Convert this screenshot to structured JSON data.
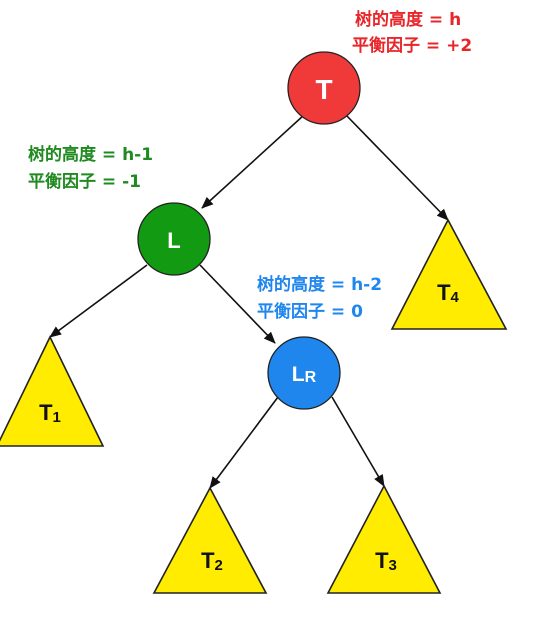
{
  "colors": {
    "root": "#f03a3a",
    "left": "#139a13",
    "lr": "#1f86ee",
    "subtree": "#ffec00",
    "red_text": "#e8262a",
    "green_text": "#1f8a1f",
    "blue_text": "#1f86ee"
  },
  "nodes": {
    "root": "T",
    "left": "L",
    "lr_main": "L",
    "lr_sub": "R"
  },
  "subtrees": {
    "t1_main": "T",
    "t1_sub": "1",
    "t2_main": "T",
    "t2_sub": "2",
    "t3_main": "T",
    "t3_sub": "3",
    "t4_main": "T",
    "t4_sub": "4"
  },
  "annotations": {
    "root": {
      "height": "树的高度 = h",
      "balance": "平衡因子 = +2"
    },
    "left": {
      "height": "树的高度 = h-1",
      "balance": "平衡因子 = -1"
    },
    "lr": {
      "height": "树的高度 = h-2",
      "balance": "平衡因子 = 0"
    }
  }
}
